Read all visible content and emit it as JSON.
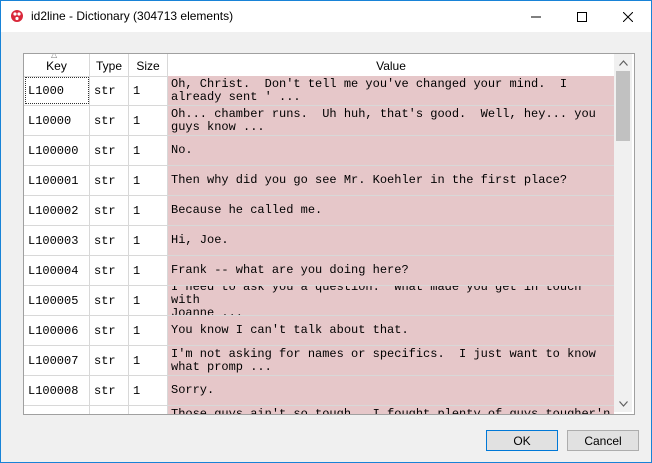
{
  "window": {
    "title": "id2line - Dictionary (304713 elements)"
  },
  "table": {
    "columns": [
      "Key",
      "Type",
      "Size",
      "Value"
    ],
    "rows": [
      {
        "key": "L1000",
        "type": "str",
        "size": "1",
        "value": "Oh, Christ.  Don't tell me you've changed your mind.  I\nalready sent ' ..."
      },
      {
        "key": "L10000",
        "type": "str",
        "size": "1",
        "value": "Oh... chamber runs.  Uh huh, that's good.  Well, hey... you\nguys know ..."
      },
      {
        "key": "L100000",
        "type": "str",
        "size": "1",
        "value": "No."
      },
      {
        "key": "L100001",
        "type": "str",
        "size": "1",
        "value": "Then why did you go see Mr. Koehler in the first place?"
      },
      {
        "key": "L100002",
        "type": "str",
        "size": "1",
        "value": "Because he called me."
      },
      {
        "key": "L100003",
        "type": "str",
        "size": "1",
        "value": "Hi, Joe."
      },
      {
        "key": "L100004",
        "type": "str",
        "size": "1",
        "value": "Frank -- what are you doing here?"
      },
      {
        "key": "L100005",
        "type": "str",
        "size": "1",
        "value": "I need to ask you a question.  What made you get in touch with\nJoanne ..."
      },
      {
        "key": "L100006",
        "type": "str",
        "size": "1",
        "value": "You know I can't talk about that."
      },
      {
        "key": "L100007",
        "type": "str",
        "size": "1",
        "value": "I'm not asking for names or specifics.  I just want to know\nwhat promp ..."
      },
      {
        "key": "L100008",
        "type": "str",
        "size": "1",
        "value": "Sorry."
      },
      {
        "key": "",
        "type": "",
        "size": "",
        "value": "Those guys ain't so tough.  I fought plenty of guys tougher'n"
      }
    ]
  },
  "buttons": {
    "ok": "OK",
    "cancel": "Cancel"
  },
  "colors": {
    "value_cell_bg": "#e6c7c9",
    "window_border": "#1883d7",
    "ok_border": "#0078d7"
  },
  "icons": [
    "app-icon",
    "minimize-icon",
    "maximize-icon",
    "close-icon",
    "sort-up-icon",
    "scroll-up-icon",
    "scroll-down-icon"
  ]
}
